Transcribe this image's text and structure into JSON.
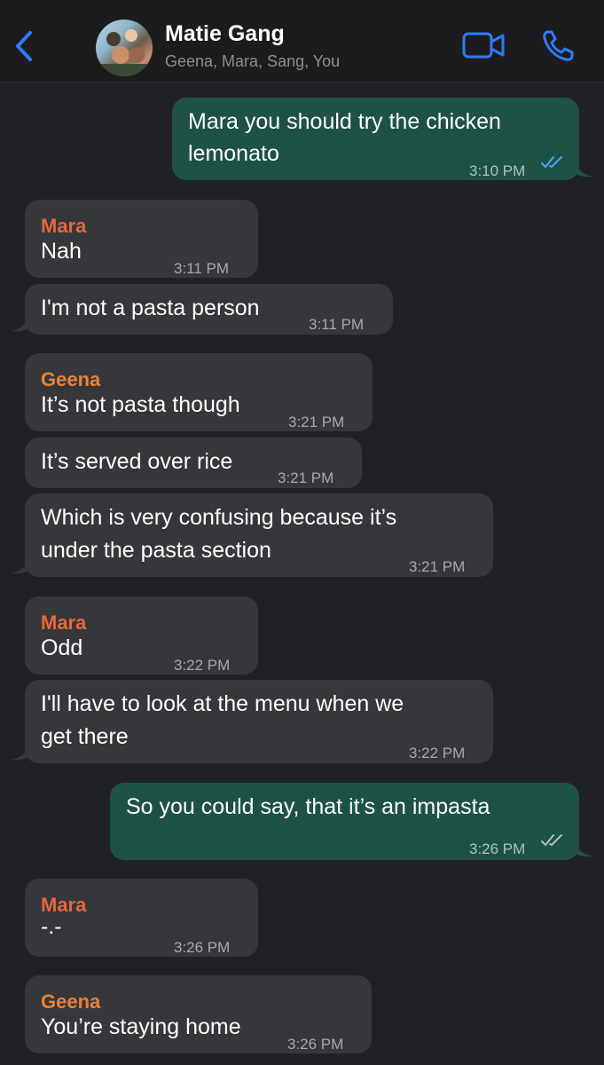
{
  "header": {
    "title": "Matie Gang",
    "subtitle": "Geena, Mara, Sang, You"
  },
  "colors": {
    "accent": "#2f7bf6",
    "incoming_bubble": "#36373a",
    "outgoing_bubble": "#1e5245",
    "mara_name": "#e8663b",
    "geena_name": "#e8833b"
  },
  "messages": [
    {
      "sender": "",
      "lines": [
        "Mara you should try the chicken",
        "lemonato"
      ],
      "time": "3:10 PM",
      "outgoing": true,
      "status": "read"
    },
    {
      "sender": "Mara",
      "lines": [
        "Nah"
      ],
      "time": "3:11 PM"
    },
    {
      "sender": "",
      "lines": [
        "I'm not a pasta person"
      ],
      "time": "3:11 PM"
    },
    {
      "sender": "Geena",
      "lines": [
        "It’s not pasta though"
      ],
      "time": "3:21 PM"
    },
    {
      "sender": "",
      "lines": [
        "It’s served over rice"
      ],
      "time": "3:21 PM"
    },
    {
      "sender": "",
      "lines": [
        "Which is very confusing because it’s",
        "under the pasta section"
      ],
      "time": "3:21 PM"
    },
    {
      "sender": "Mara",
      "lines": [
        "Odd"
      ],
      "time": "3:22 PM"
    },
    {
      "sender": "",
      "lines": [
        "I'll have to look at the menu when we",
        "get there"
      ],
      "time": "3:22 PM"
    },
    {
      "sender": "",
      "lines": [
        "So you could say, that it’s an impasta"
      ],
      "time": "3:26 PM",
      "outgoing": true,
      "status": "delivered"
    },
    {
      "sender": "Mara",
      "lines": [
        "-.-"
      ],
      "time": "3:26 PM"
    },
    {
      "sender": "Geena",
      "lines": [
        "You’re staying home"
      ],
      "time": "3:26 PM"
    }
  ]
}
